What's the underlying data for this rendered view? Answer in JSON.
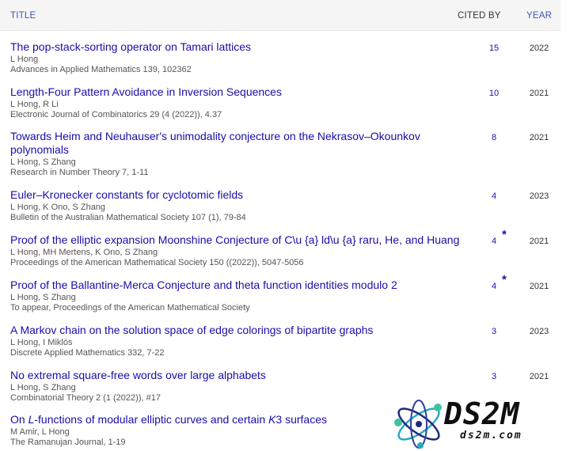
{
  "header": {
    "title": "TITLE",
    "cited_by": "CITED BY",
    "year": "YEAR"
  },
  "articles": [
    {
      "title": "The pop-stack-sorting operator on Tamari lattices",
      "authors": "L Hong",
      "venue": "Advances in Applied Mathematics 139, 102362",
      "cited": "15",
      "year": "2022"
    },
    {
      "title": "Length-Four Pattern Avoidance in Inversion Sequences",
      "authors": "L Hong, R Li",
      "venue": "Electronic Journal of Combinatorics 29 (4 (2022)), 4.37",
      "cited": "10",
      "year": "2021"
    },
    {
      "title": "Towards Heim and Neuhauser's unimodality conjecture on the Nekrasov–Okounkov polynomials",
      "authors": "L Hong, S Zhang",
      "venue": "Research in Number Theory 7, 1-11",
      "cited": "8",
      "year": "2021"
    },
    {
      "title": "Euler–Kronecker constants for cyclotomic fields",
      "authors": "L Hong, K Ono, S Zhang",
      "venue": "Bulletin of the Australian Mathematical Society 107 (1), 79-84",
      "cited": "4",
      "year": "2023"
    },
    {
      "title": "Proof of the elliptic expansion Moonshine Conjecture of C\\u {a} ld\\u {a} raru, He, and Huang",
      "authors": "L Hong, MH Mertens, K Ono, S Zhang",
      "venue": "Proceedings of the American Mathematical Society 150 ((2022)), 5047-5056",
      "cited": "4",
      "star": "*",
      "year": "2021"
    },
    {
      "title": "Proof of the Ballantine-Merca Conjecture and theta function identities modulo 2",
      "authors": "L Hong, S Zhang",
      "venue": "To appear, Proceedings of the American Mathematical Society",
      "cited": "4",
      "star": "*",
      "year": "2021"
    },
    {
      "title": "A Markov chain on the solution space of edge colorings of bipartite graphs",
      "authors": "L Hong, I Miklós",
      "venue": "Discrete Applied Mathematics 332, 7-22",
      "cited": "3",
      "year": "2023"
    },
    {
      "title": "No extremal square-free words over large alphabets",
      "authors": "L Hong, S Zhang",
      "venue": "Combinatorial Theory 2 (1 (2022)), #17",
      "cited": "3",
      "year": "2021"
    }
  ],
  "last_article": {
    "title_a": "On ",
    "title_b": "L",
    "title_c": "-functions of modular elliptic curves and certain ",
    "title_d": "K",
    "title_e": "3 surfaces",
    "authors": "M Amir, L Hong",
    "venue": "The Ramanujan Journal, 1-19"
  },
  "watermark": {
    "brand": "DS2M",
    "sub": "ds2m.com"
  }
}
